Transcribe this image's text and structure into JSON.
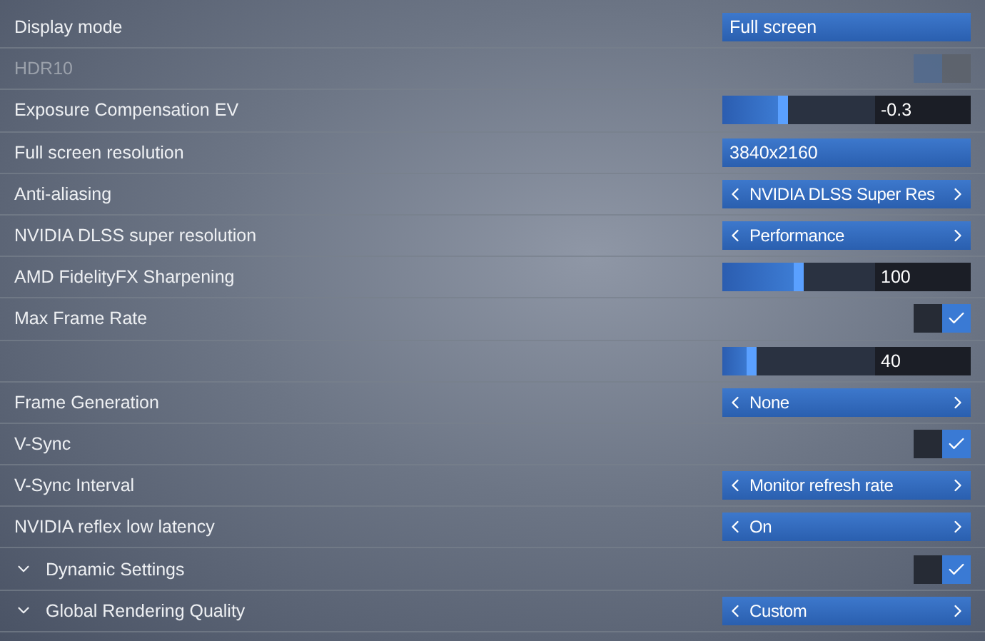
{
  "settings": [
    {
      "label": "Display mode",
      "control": {
        "kind": "value",
        "value": "Full screen"
      }
    },
    {
      "label": "HDR10",
      "disabled": true,
      "control": {
        "kind": "toggle",
        "on": false
      }
    },
    {
      "label": "Exposure Compensation EV",
      "control": {
        "kind": "slider",
        "level": 0.4,
        "reading": "-0.3"
      }
    },
    {
      "label": "Full screen resolution",
      "control": {
        "kind": "value",
        "value": "3840x2160"
      }
    },
    {
      "label": "Anti-aliasing",
      "control": {
        "kind": "selector",
        "value": "NVIDIA DLSS Super Res"
      }
    },
    {
      "label": "NVIDIA DLSS super resolution",
      "control": {
        "kind": "selector",
        "value": "Performance"
      }
    },
    {
      "label": "AMD FidelityFX Sharpening",
      "control": {
        "kind": "slider",
        "level": 0.5,
        "reading": "100"
      }
    },
    {
      "label": "Max Frame Rate",
      "control": {
        "kind": "checkbox",
        "checked": true
      }
    },
    {
      "control": {
        "kind": "slider",
        "level": 0.2,
        "reading": "40"
      }
    },
    {
      "label": "Frame Generation",
      "control": {
        "kind": "selector",
        "value": "None"
      }
    },
    {
      "label": "V-Sync",
      "control": {
        "kind": "checkbox",
        "checked": true
      }
    },
    {
      "label": "V-Sync Interval",
      "control": {
        "kind": "selector",
        "value": "Monitor refresh rate"
      }
    },
    {
      "label": "NVIDIA reflex low latency",
      "control": {
        "kind": "selector",
        "value": "On"
      }
    },
    {
      "label": "Dynamic Settings",
      "expanded": true,
      "control": {
        "kind": "checkbox",
        "checked": true
      }
    },
    {
      "label": "Global Rendering Quality",
      "expanded": true,
      "control": {
        "kind": "selector",
        "value": "Custom"
      }
    }
  ]
}
